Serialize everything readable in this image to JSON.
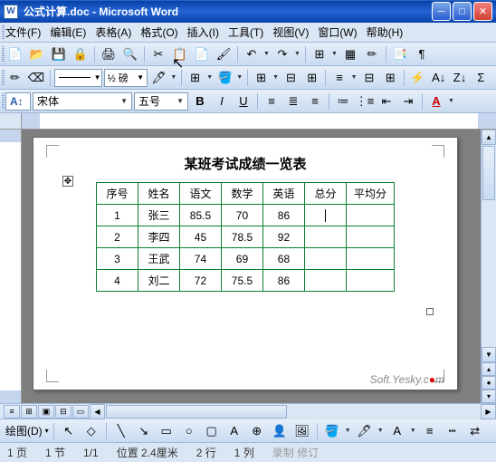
{
  "window": {
    "title": "公式计算.doc - Microsoft Word"
  },
  "menu": {
    "items": [
      "文件(F)",
      "编辑(E)",
      "表格(A)",
      "格式(O)",
      "插入(I)",
      "工具(T)",
      "视图(V)",
      "窗口(W)",
      "帮助(H)"
    ]
  },
  "formatting": {
    "style_label": "A↕",
    "font_label": "宋体",
    "size_label": "五号",
    "bold": "B",
    "italic": "I",
    "underline": "U"
  },
  "document": {
    "title": "某班考试成绩一览表",
    "headers": [
      "序号",
      "姓名",
      "语文",
      "数学",
      "英语",
      "总分",
      "平均分"
    ],
    "rows": [
      {
        "num": "1",
        "name": "张三",
        "chinese": "85.5",
        "math": "70",
        "english": "86",
        "total": "",
        "avg": ""
      },
      {
        "num": "2",
        "name": "李四",
        "chinese": "45",
        "math": "78.5",
        "english": "92",
        "total": "",
        "avg": ""
      },
      {
        "num": "3",
        "name": "王武",
        "chinese": "74",
        "math": "69",
        "english": "68",
        "total": "",
        "avg": ""
      },
      {
        "num": "4",
        "name": "刘二",
        "chinese": "72",
        "math": "75.5",
        "english": "86",
        "total": "",
        "avg": ""
      }
    ]
  },
  "chart_data": {
    "type": "table",
    "title": "某班考试成绩一览表",
    "columns": [
      "序号",
      "姓名",
      "语文",
      "数学",
      "英语",
      "总分",
      "平均分"
    ],
    "data": [
      [
        1,
        "张三",
        85.5,
        70,
        86,
        null,
        null
      ],
      [
        2,
        "李四",
        45,
        78.5,
        92,
        null,
        null
      ],
      [
        3,
        "王武",
        74,
        69,
        68,
        null,
        null
      ],
      [
        4,
        "刘二",
        72,
        75.5,
        86,
        null,
        null
      ]
    ]
  },
  "status": {
    "page": "1 页",
    "section": "1 节",
    "pages": "1/1",
    "position": "位置 2.4厘米",
    "line": "2 行",
    "column": "1 列",
    "mode": "录制 修订"
  },
  "watermark": "Soft.Yesky.c●m",
  "draw_label": "绘图(D)"
}
